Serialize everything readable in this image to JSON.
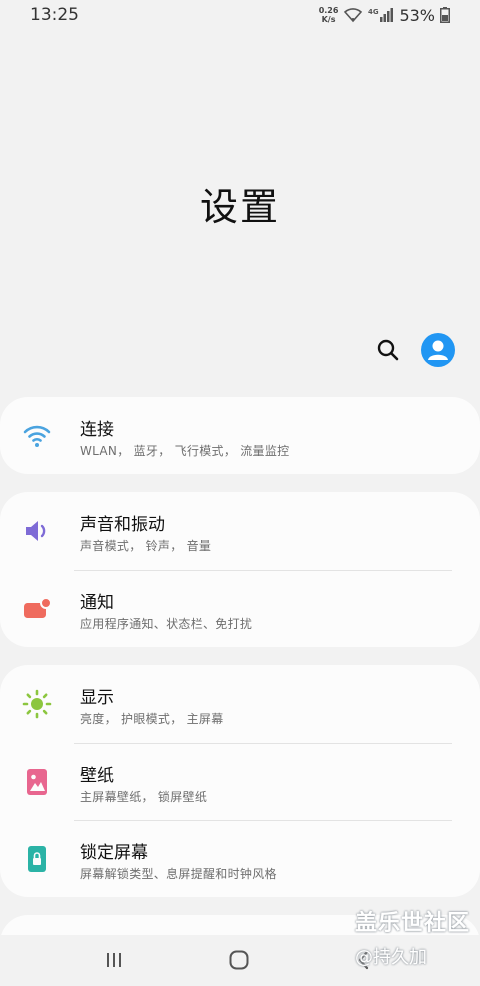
{
  "status_bar": {
    "time": "13:25",
    "net_speed_value": "0.26",
    "net_speed_unit": "K/s",
    "network_type": "4G",
    "battery_percent": "53%"
  },
  "header": {
    "title": "设置"
  },
  "groups": [
    {
      "items": [
        {
          "title": "连接",
          "subtitle": "WLAN， 蓝牙， 飞行模式， 流量监控",
          "icon": "wifi-icon",
          "color": "#4aa3df"
        }
      ]
    },
    {
      "items": [
        {
          "title": "声音和振动",
          "subtitle": "声音模式， 铃声， 音量",
          "icon": "volume-icon",
          "color": "#7e6bd6"
        },
        {
          "title": "通知",
          "subtitle": "应用程序通知、状态栏、免打扰",
          "icon": "notification-icon",
          "color": "#ef6b5e"
        }
      ]
    },
    {
      "items": [
        {
          "title": "显示",
          "subtitle": "亮度， 护眼模式， 主屏幕",
          "icon": "brightness-icon",
          "color": "#8cc63f"
        },
        {
          "title": "壁纸",
          "subtitle": "主屏幕壁纸， 锁屏壁纸",
          "icon": "wallpaper-icon",
          "color": "#e8668f"
        },
        {
          "title": "锁定屏幕",
          "subtitle": "屏幕解锁类型、息屏提醒和时钟风格",
          "icon": "lock-screen-icon",
          "color": "#2bb3a6"
        }
      ]
    }
  ],
  "watermark": {
    "main": "盖乐世社区",
    "sub": "@持久加"
  },
  "colors": {
    "background": "#f2f2f2",
    "card": "#fcfcfc",
    "accent": "#2196f3"
  }
}
